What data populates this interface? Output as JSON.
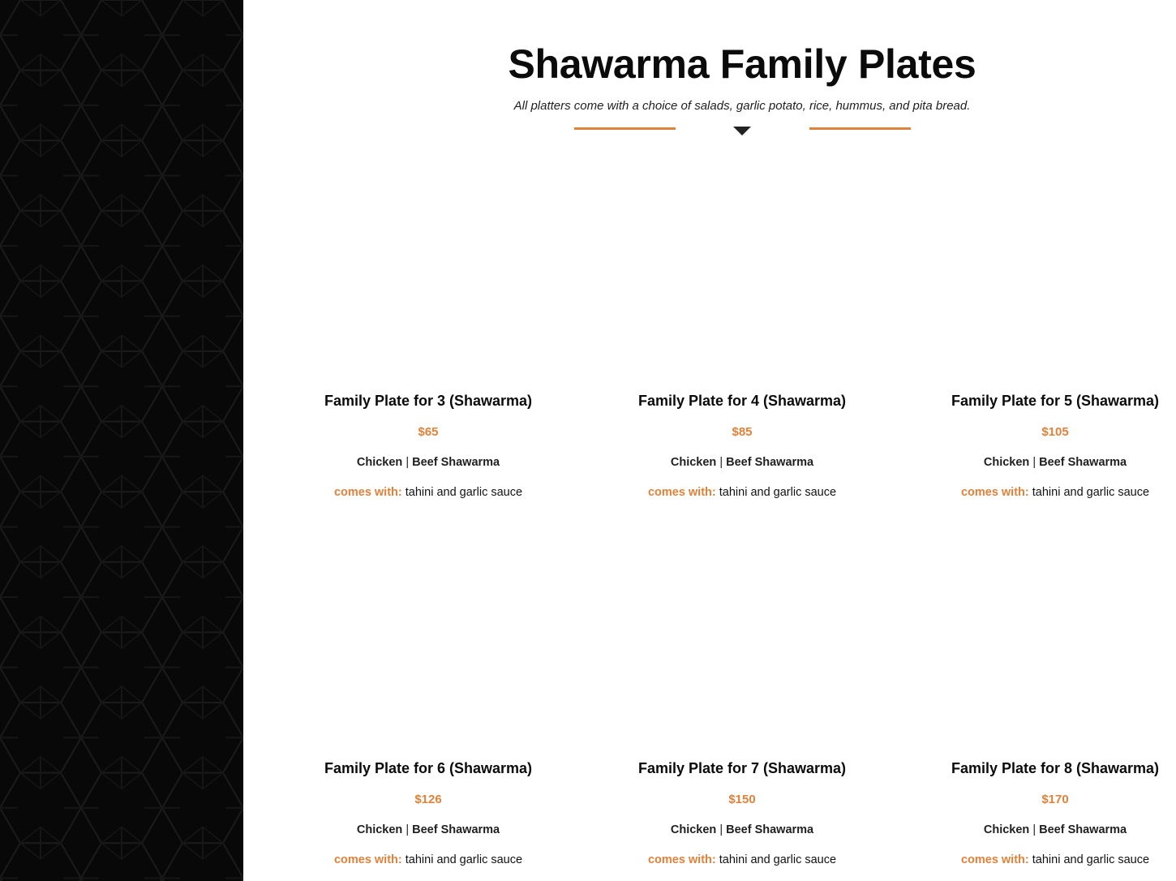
{
  "colors": {
    "accent": "#e0823a",
    "sidebar_background": "#080808",
    "heading": "#0b0b0b"
  },
  "section": {
    "title": "Shawarma Family Plates",
    "subtitle": "All platters come with a choice of salads, garlic potato, rice, hummus, and pita bread.",
    "divider_icon": "caret-down-icon"
  },
  "plates": [
    {
      "name": "Family Plate for 3 (Shawarma)",
      "price": "$65",
      "meat_1": "Chicken",
      "separator": " | ",
      "meat_2": "Beef Shawarma",
      "comes_label": "comes with:",
      "comes_value": " tahini and garlic sauce"
    },
    {
      "name": "Family Plate for 4 (Shawarma)",
      "price": "$85",
      "meat_1": "Chicken",
      "separator": " | ",
      "meat_2": "Beef Shawarma",
      "comes_label": "comes with:",
      "comes_value": " tahini and garlic sauce"
    },
    {
      "name": "Family Plate for 5 (Shawarma)",
      "price": "$105",
      "meat_1": "Chicken",
      "separator": " | ",
      "meat_2": "Beef Shawarma",
      "comes_label": "comes with:",
      "comes_value": " tahini and garlic sauce"
    },
    {
      "name": "Family Plate for 6 (Shawarma)",
      "price": "$126",
      "meat_1": "Chicken",
      "separator": " | ",
      "meat_2": "Beef Shawarma",
      "comes_label": "comes with:",
      "comes_value": " tahini and garlic sauce"
    },
    {
      "name": "Family Plate for 7 (Shawarma)",
      "price": "$150",
      "meat_1": "Chicken",
      "separator": " | ",
      "meat_2": "Beef Shawarma",
      "comes_label": "comes with:",
      "comes_value": " tahini and garlic sauce"
    },
    {
      "name": "Family Plate for 8 (Shawarma)",
      "price": "$170",
      "meat_1": "Chicken",
      "separator": " | ",
      "meat_2": "Beef Shawarma",
      "comes_label": "comes with:",
      "comes_value": " tahini and garlic sauce"
    }
  ]
}
